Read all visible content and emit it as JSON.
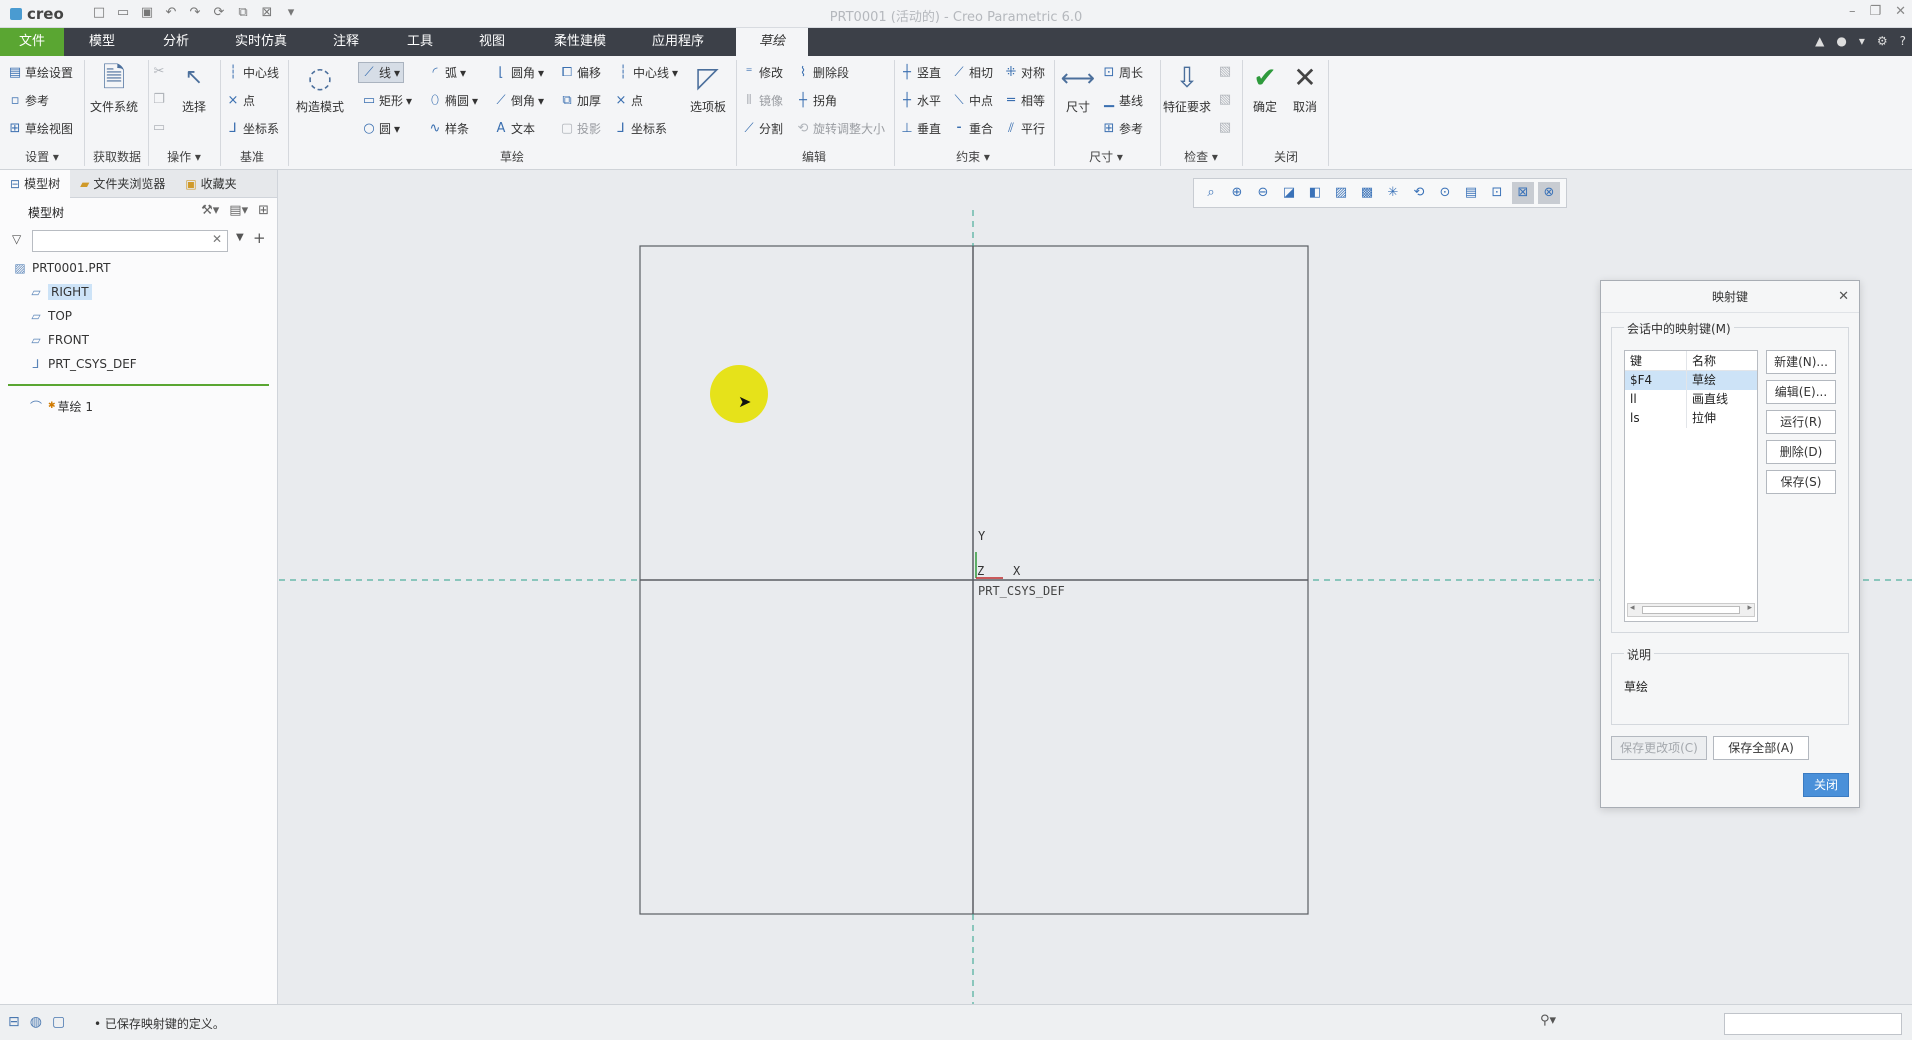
{
  "titlebar": {
    "logo": "creo",
    "window_title": "PRT0001 (活动的) - Creo Parametric 6.0"
  },
  "menu": {
    "tabs": [
      "文件",
      "模型",
      "分析",
      "实时仿真",
      "注释",
      "工具",
      "视图",
      "柔性建模",
      "应用程序",
      "草绘"
    ],
    "active": "草绘"
  },
  "ribbon": {
    "setup": {
      "sketch_setup": "草绘设置",
      "reference": "参考",
      "sketch_view": "草绘视图",
      "group": "设置"
    },
    "get_data": {
      "file_system": "文件系统",
      "group": "获取数据"
    },
    "operations": {
      "select": "选择",
      "group": "操作"
    },
    "datum": {
      "centerline": "中心线",
      "point": "点",
      "csys": "坐标系",
      "group": "基准"
    },
    "sketching": {
      "construction_mode": "构造模式",
      "line": "线",
      "arc": "弧",
      "fillet": "圆角",
      "offset": "偏移",
      "centerline": "中心线",
      "rectangle": "矩形",
      "ellipse": "椭圆",
      "chamfer": "倒角",
      "thicken": "加厚",
      "point": "点",
      "circle": "圆",
      "spline": "样条",
      "text": "文本",
      "project": "投影",
      "csys": "坐标系",
      "palette": "选项板",
      "group": "草绘"
    },
    "editing": {
      "modify": "修改",
      "delete_segment": "删除段",
      "mirror": "镜像",
      "corner": "拐角",
      "divide": "分割",
      "rotate_resize": "旋转调整大小",
      "group": "编辑"
    },
    "constrain": {
      "vertical": "竖直",
      "tangent": "相切",
      "symmetric": "对称",
      "horizontal": "水平",
      "midpoint": "中点",
      "equal": "相等",
      "perpendicular": "垂直",
      "coincident": "重合",
      "parallel": "平行",
      "group": "约束"
    },
    "dimension": {
      "dimension": "尺寸",
      "perimeter": "周长",
      "baseline": "基线",
      "reference": "参考",
      "group": "尺寸"
    },
    "inspect": {
      "feature_requirements": "特征要求",
      "group": "检查"
    },
    "close": {
      "ok": "确定",
      "cancel": "取消",
      "group": "关闭"
    }
  },
  "left_panel": {
    "tabs": [
      "模型树",
      "文件夹浏览器",
      "收藏夹"
    ],
    "tree_header": "模型树",
    "filter_placeholder": "",
    "items": [
      {
        "label": "PRT0001.PRT",
        "icon": "part-icon"
      },
      {
        "label": "RIGHT",
        "icon": "datum-plane-icon",
        "selected": true
      },
      {
        "label": "TOP",
        "icon": "datum-plane-icon"
      },
      {
        "label": "FRONT",
        "icon": "datum-plane-icon"
      },
      {
        "label": "PRT_CSYS_DEF",
        "icon": "csys-icon"
      }
    ],
    "sketch_item": "草绘 1"
  },
  "canvas": {
    "axis_y": "Y",
    "axis_z": "Z",
    "axis_x": "X",
    "csys_label": "PRT_CSYS_DEF"
  },
  "dialog": {
    "title": "映射键",
    "session_group": "会话中的映射键(M)",
    "columns": [
      "键",
      "名称"
    ],
    "rows": [
      {
        "key": "$F4",
        "name": "草绘",
        "selected": true
      },
      {
        "key": "ll",
        "name": "画直线"
      },
      {
        "key": "ls",
        "name": "拉伸"
      }
    ],
    "buttons": {
      "new": "新建(N)...",
      "edit": "编辑(E)...",
      "run": "运行(R)",
      "delete": "删除(D)",
      "save": "保存(S)"
    },
    "desc_group": "说明",
    "description": "草绘",
    "save_changed": "保存更改项(C)",
    "save_all": "保存全部(A)",
    "close": "关闭"
  },
  "status": {
    "message": "• 已保存映射键的定义。"
  },
  "colors": {
    "file_tab": "#5aa632",
    "menubar": "#3c4048",
    "datum_line": "#2aa18a",
    "highlight": "#e6e21a",
    "selection": "#cde3f7"
  }
}
